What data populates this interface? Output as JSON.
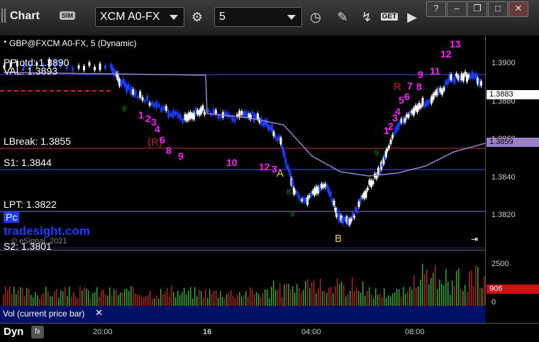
{
  "header": {
    "title": "Chart",
    "badge": "SIM",
    "symbol": "XCM A0-FX",
    "interval": "5",
    "get_label": "GET"
  },
  "chart": {
    "description": "* GBP@FXCM A0-FX, 5 (Dynamic)",
    "levels": {
      "pivot": "PP otd: 1.3890",
      "val": "VAL: 1.3893",
      "lbreak": "LBreak: 1.3855",
      "s1": "S1: 1.3844",
      "lpt": "LPT: 1.3822",
      "pc": "Pc",
      "s2": "S2: 1.3801"
    },
    "watermark": "tradesight.com",
    "copyright": "© eSignal, 2021",
    "price_ticks": [
      "1.3900",
      "1.3880",
      "1.3860",
      "1.3840",
      "1.3820"
    ],
    "last_price": "1.3883",
    "ma_price": "1.3859",
    "markers": {
      "a": "A",
      "b": "B"
    },
    "counts": [
      "1",
      "2",
      "3",
      "4",
      "5",
      "6",
      "8",
      "9",
      "10",
      "11",
      "12",
      "7",
      "13",
      "R",
      "(R)"
    ]
  },
  "volume": {
    "label": "Vol (current price bar)",
    "ticks": [
      "2500",
      "0"
    ],
    "current": "906"
  },
  "footer": {
    "mode": "Dyn",
    "fx": "fx",
    "times": [
      "20:00",
      "16",
      "04:00",
      "08:00"
    ]
  },
  "colors": {
    "candle_up": "#ffffff",
    "candle_down": "#1a3cff",
    "ma": "#9a80c8",
    "count": "#ff20ff",
    "vol_up": "#2ea82e",
    "vol_down": "#b02020"
  }
}
